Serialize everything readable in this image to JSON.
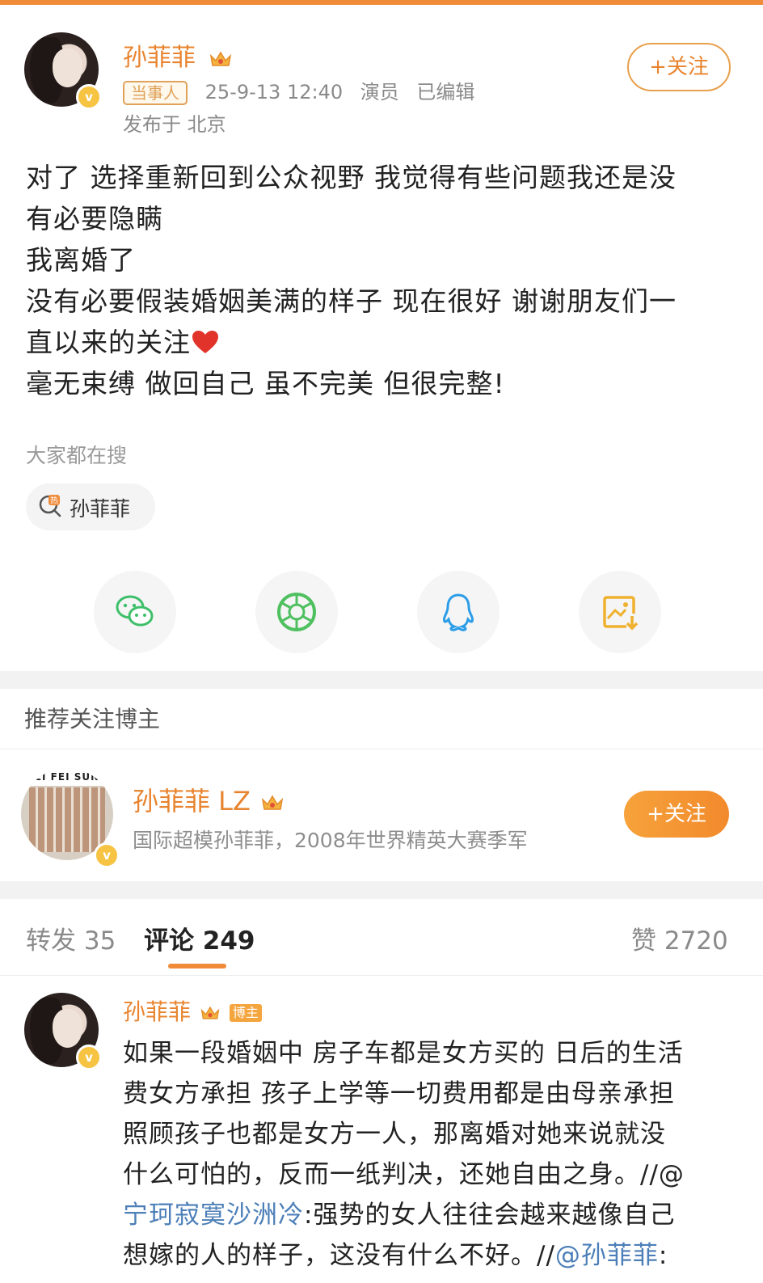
{
  "post": {
    "username": "孙菲菲",
    "tag": "当事人",
    "time": "25-9-13 12:40",
    "role": "演员",
    "edited": "已编辑",
    "location": "发布于 北京",
    "follow_label": "+关注",
    "lines": [
      "对了 选择重新回到公众视野 我觉得有些问题我还是没",
      "有必要隐瞒",
      "我离婚了",
      "没有必要假装婚姻美满的样子 现在很好 谢谢朋友们一",
      "直以来的关注",
      "毫无束缚 做回自己 虽不完美 但很完整!"
    ],
    "searching_label": "大家都在搜",
    "search_chip": "孙菲菲"
  },
  "share": {
    "icons": [
      "wechat-icon",
      "moments-icon",
      "qq-icon",
      "save-image-icon"
    ]
  },
  "recommend": {
    "title": "推荐关注博主",
    "name": "孙菲菲 LZ",
    "avatar_banner": "EI FEI SUN",
    "desc": "国际超模孙菲菲，2008年世界精英大赛季军",
    "follow_label": "+关注"
  },
  "tabs": {
    "repost": "转发 35",
    "comments": "评论 249",
    "likes": "赞 2720"
  },
  "comment": {
    "username": "孙菲菲",
    "badge": "博主",
    "lines": [
      "如果一段婚姻中 房子车都是女方买的 日后的生活",
      "费女方承担 孩子上学等一切费用都是由母亲承担",
      "照顾孩子也都是女方一人，那离婚对她来说就没",
      "什么可怕的，反而一纸判决，还她自由之身。//@"
    ],
    "mention_1": "宁珂寂寞沙洲冷",
    "line_5_rest": ":强势的女人往往会越来越像自己",
    "line_6_start": "想嫁的人的样子，这没有什么不好。//",
    "mention_2": "@孙菲菲",
    "line_6_end": ":"
  },
  "colors": {
    "accent": "#f08b3a",
    "username": "#e8842f",
    "link": "#4c7fb8",
    "verified": "#f6c343"
  }
}
